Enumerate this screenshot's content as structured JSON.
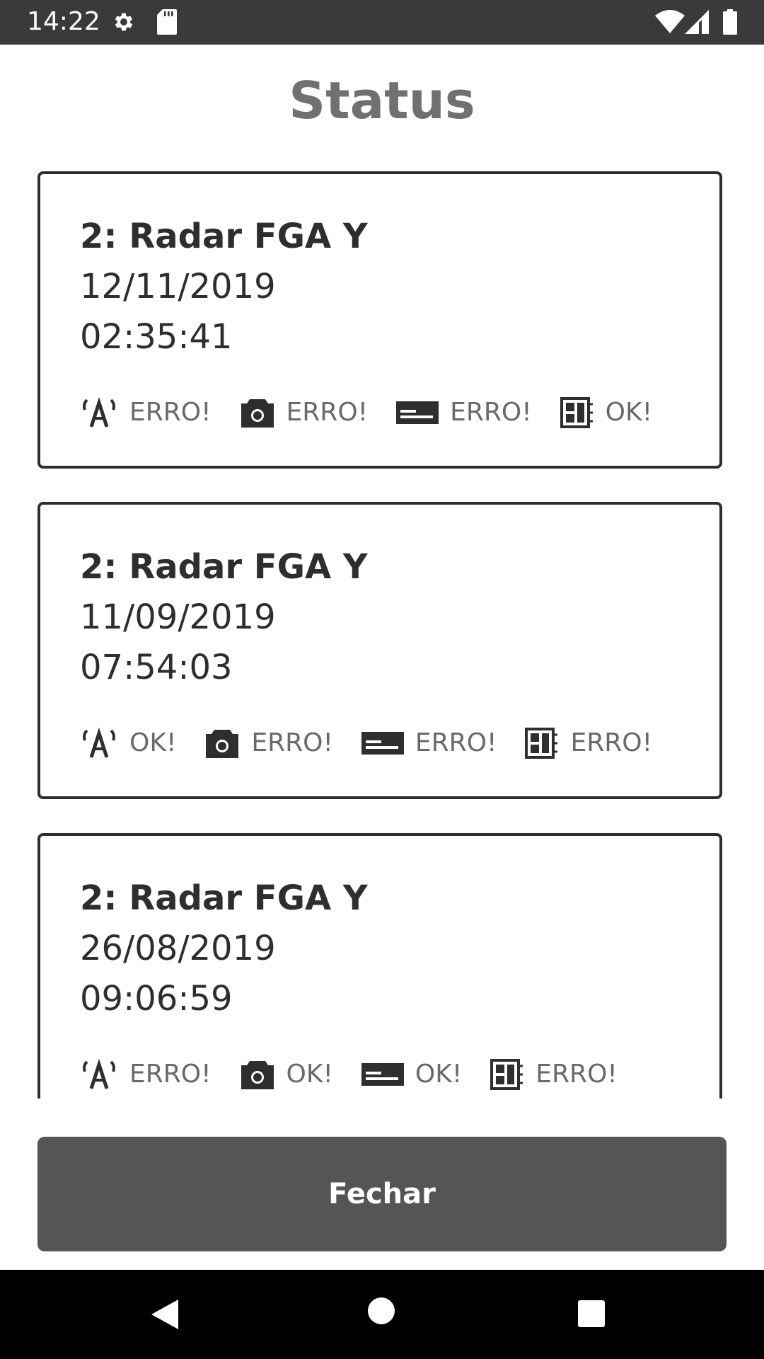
{
  "status_bar": {
    "time": "14:22",
    "icons": [
      "gear-icon",
      "sd-card-icon",
      "wifi-icon",
      "signal-icon",
      "battery-icon"
    ]
  },
  "page": {
    "title": "Status"
  },
  "records": [
    {
      "name": "2: Radar FGA Y",
      "date": "12/11/2019",
      "time": "02:35:41",
      "statuses": [
        {
          "icon": "antenna-icon",
          "label": "ERRO!"
        },
        {
          "icon": "camera-icon",
          "label": "ERRO!"
        },
        {
          "icon": "card-reader-icon",
          "label": "ERRO!"
        },
        {
          "icon": "board-icon",
          "label": "OK!"
        }
      ]
    },
    {
      "name": "2: Radar FGA Y",
      "date": "11/09/2019",
      "time": "07:54:03",
      "statuses": [
        {
          "icon": "antenna-icon",
          "label": "OK!"
        },
        {
          "icon": "camera-icon",
          "label": "ERRO!"
        },
        {
          "icon": "card-reader-icon",
          "label": "ERRO!"
        },
        {
          "icon": "board-icon",
          "label": "ERRO!"
        }
      ]
    },
    {
      "name": "2: Radar FGA Y",
      "date": "26/08/2019",
      "time": "09:06:59",
      "statuses": [
        {
          "icon": "antenna-icon",
          "label": "ERRO!"
        },
        {
          "icon": "camera-icon",
          "label": "OK!"
        },
        {
          "icon": "card-reader-icon",
          "label": "OK!"
        },
        {
          "icon": "board-icon",
          "label": "ERRO!"
        }
      ]
    }
  ],
  "actions": {
    "close_label": "Fechar"
  },
  "nav_bar": {
    "buttons": [
      "back-icon",
      "home-icon",
      "recents-icon"
    ]
  },
  "colors": {
    "status_bar": "#3a3a3a",
    "title": "#707070",
    "card_border": "#2e2e2e",
    "status_text": "#6a6a6a",
    "button": "#555555",
    "nav_bar": "#000000"
  }
}
